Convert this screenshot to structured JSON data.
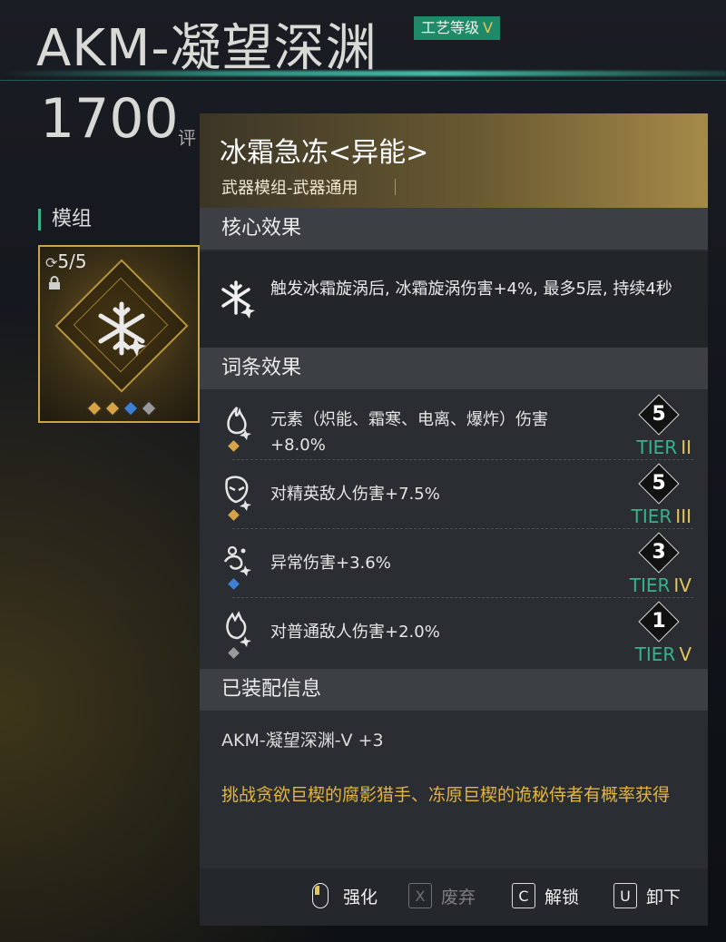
{
  "header": {
    "title": "AKM-凝望深渊",
    "craft_label": "工艺等级",
    "craft_level": "V",
    "score": "1700",
    "score_suffix": "评"
  },
  "modules": {
    "section_label": "模组",
    "count": "5/5",
    "dot_colors": [
      "#d6a447",
      "#d6a447",
      "#3f7fd4",
      "#9a9a9a"
    ]
  },
  "tooltip": {
    "name": "冰霜急冻<异能>",
    "subtitle": "武器模组-武器通用",
    "core_header": "核心效果",
    "core_text": "触发冰霜旋涡后, 冰霜旋涡伤害+4%, 最多5层, 持续4秒",
    "affix_header": "词条效果",
    "affixes": [
      {
        "text": "元素（炽能、霜寒、电离、爆炸）伤害+8.0%",
        "level": "5",
        "tier": "TIER",
        "tier_roman": "II",
        "icon": "flame-burst-icon",
        "rarity_color": "#d6a447"
      },
      {
        "text": "对精英敌人伤害+7.5%",
        "level": "5",
        "tier": "TIER",
        "tier_roman": "III",
        "icon": "elite-mask-icon",
        "rarity_color": "#d6a447"
      },
      {
        "text": "异常伤害+3.6%",
        "level": "3",
        "tier": "TIER",
        "tier_roman": "IV",
        "icon": "anomaly-swirl-icon",
        "rarity_color": "#3f7fd4"
      },
      {
        "text": "对普通敌人伤害+2.0%",
        "level": "1",
        "tier": "TIER",
        "tier_roman": "V",
        "icon": "enemy-head-icon",
        "rarity_color": "#9a9a9a"
      }
    ],
    "equip_header": "已装配信息",
    "equip_text": "AKM-凝望深渊-Ⅴ +3",
    "source_text": "挑战贪欲巨楔的腐影猎手、冻原巨楔的诡秘侍者有概率获得"
  },
  "footer": {
    "enhance_label": "强化",
    "discard_key": "X",
    "discard_label": "废弃",
    "unlock_key": "C",
    "unlock_label": "解锁",
    "unequip_key": "U",
    "unequip_label": "卸下"
  }
}
